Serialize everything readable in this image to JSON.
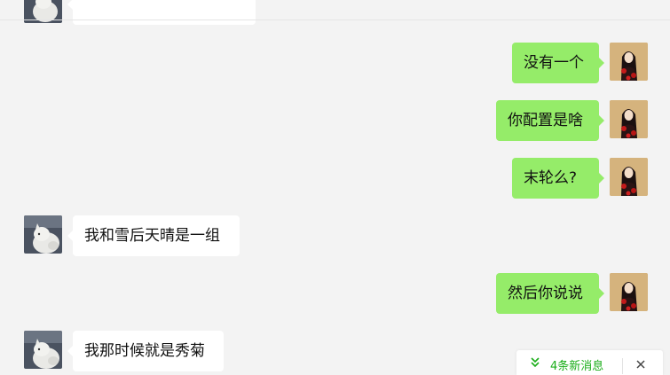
{
  "window": {
    "background": "#f3f3f3"
  },
  "colors": {
    "outgoing_bubble": "#95ec69",
    "incoming_bubble": "#ffffff",
    "new_message_accent": "#1aad19"
  },
  "messages": [
    {
      "direction": "outgoing",
      "text": "没有一个",
      "avatar_icon": "anime-girl-avatar-icon"
    },
    {
      "direction": "outgoing",
      "text": "你配置是啥",
      "avatar_icon": "anime-girl-avatar-icon"
    },
    {
      "direction": "outgoing",
      "text": "末轮么?",
      "avatar_icon": "anime-girl-avatar-icon"
    },
    {
      "direction": "incoming",
      "text": "我和雪后天晴是一组",
      "avatar_icon": "white-cat-avatar-icon"
    },
    {
      "direction": "outgoing",
      "text": "然后你说说",
      "avatar_icon": "anime-girl-avatar-icon"
    },
    {
      "direction": "incoming",
      "text": "我那时候就是秀菊",
      "avatar_icon": "white-cat-avatar-icon"
    }
  ],
  "new_messages_bar": {
    "label": "4条新消息",
    "icon": "double-chevron-down-icon",
    "close_icon": "close-icon"
  }
}
